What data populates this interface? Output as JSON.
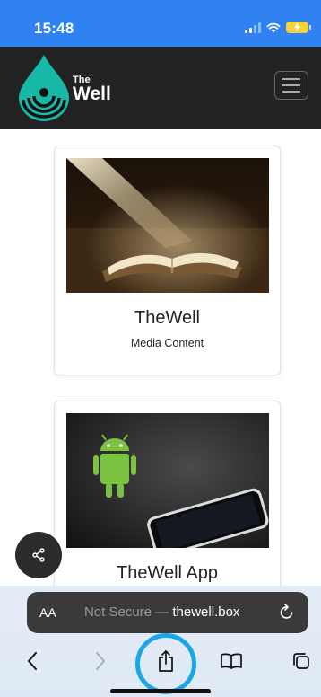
{
  "status_bar": {
    "time": "15:48"
  },
  "navbar": {
    "logo": {
      "line1": "The",
      "line2": "Well"
    },
    "menu_icon": "hamburger-icon"
  },
  "cards": [
    {
      "title": "TheWell",
      "subtitle": "Media Content",
      "image": "open-bible-with-light-beam"
    },
    {
      "title": "TheWell App",
      "image": "android-figure-with-smartphone"
    }
  ],
  "share_fab": {
    "icon": "share-nodes-icon"
  },
  "safari": {
    "text_size_label": "AA",
    "security_label": "Not Secure — ",
    "domain": "thewell.box",
    "reload_icon": "reload-icon",
    "toolbar": [
      "back-icon",
      "forward-icon",
      "share-icon",
      "bookmarks-icon",
      "tabs-icon"
    ]
  },
  "colors": {
    "status_bar": "#2f82f0",
    "navbar": "#222222",
    "logo_teal": "#17b8a6",
    "highlight": "#1aa7e4"
  }
}
